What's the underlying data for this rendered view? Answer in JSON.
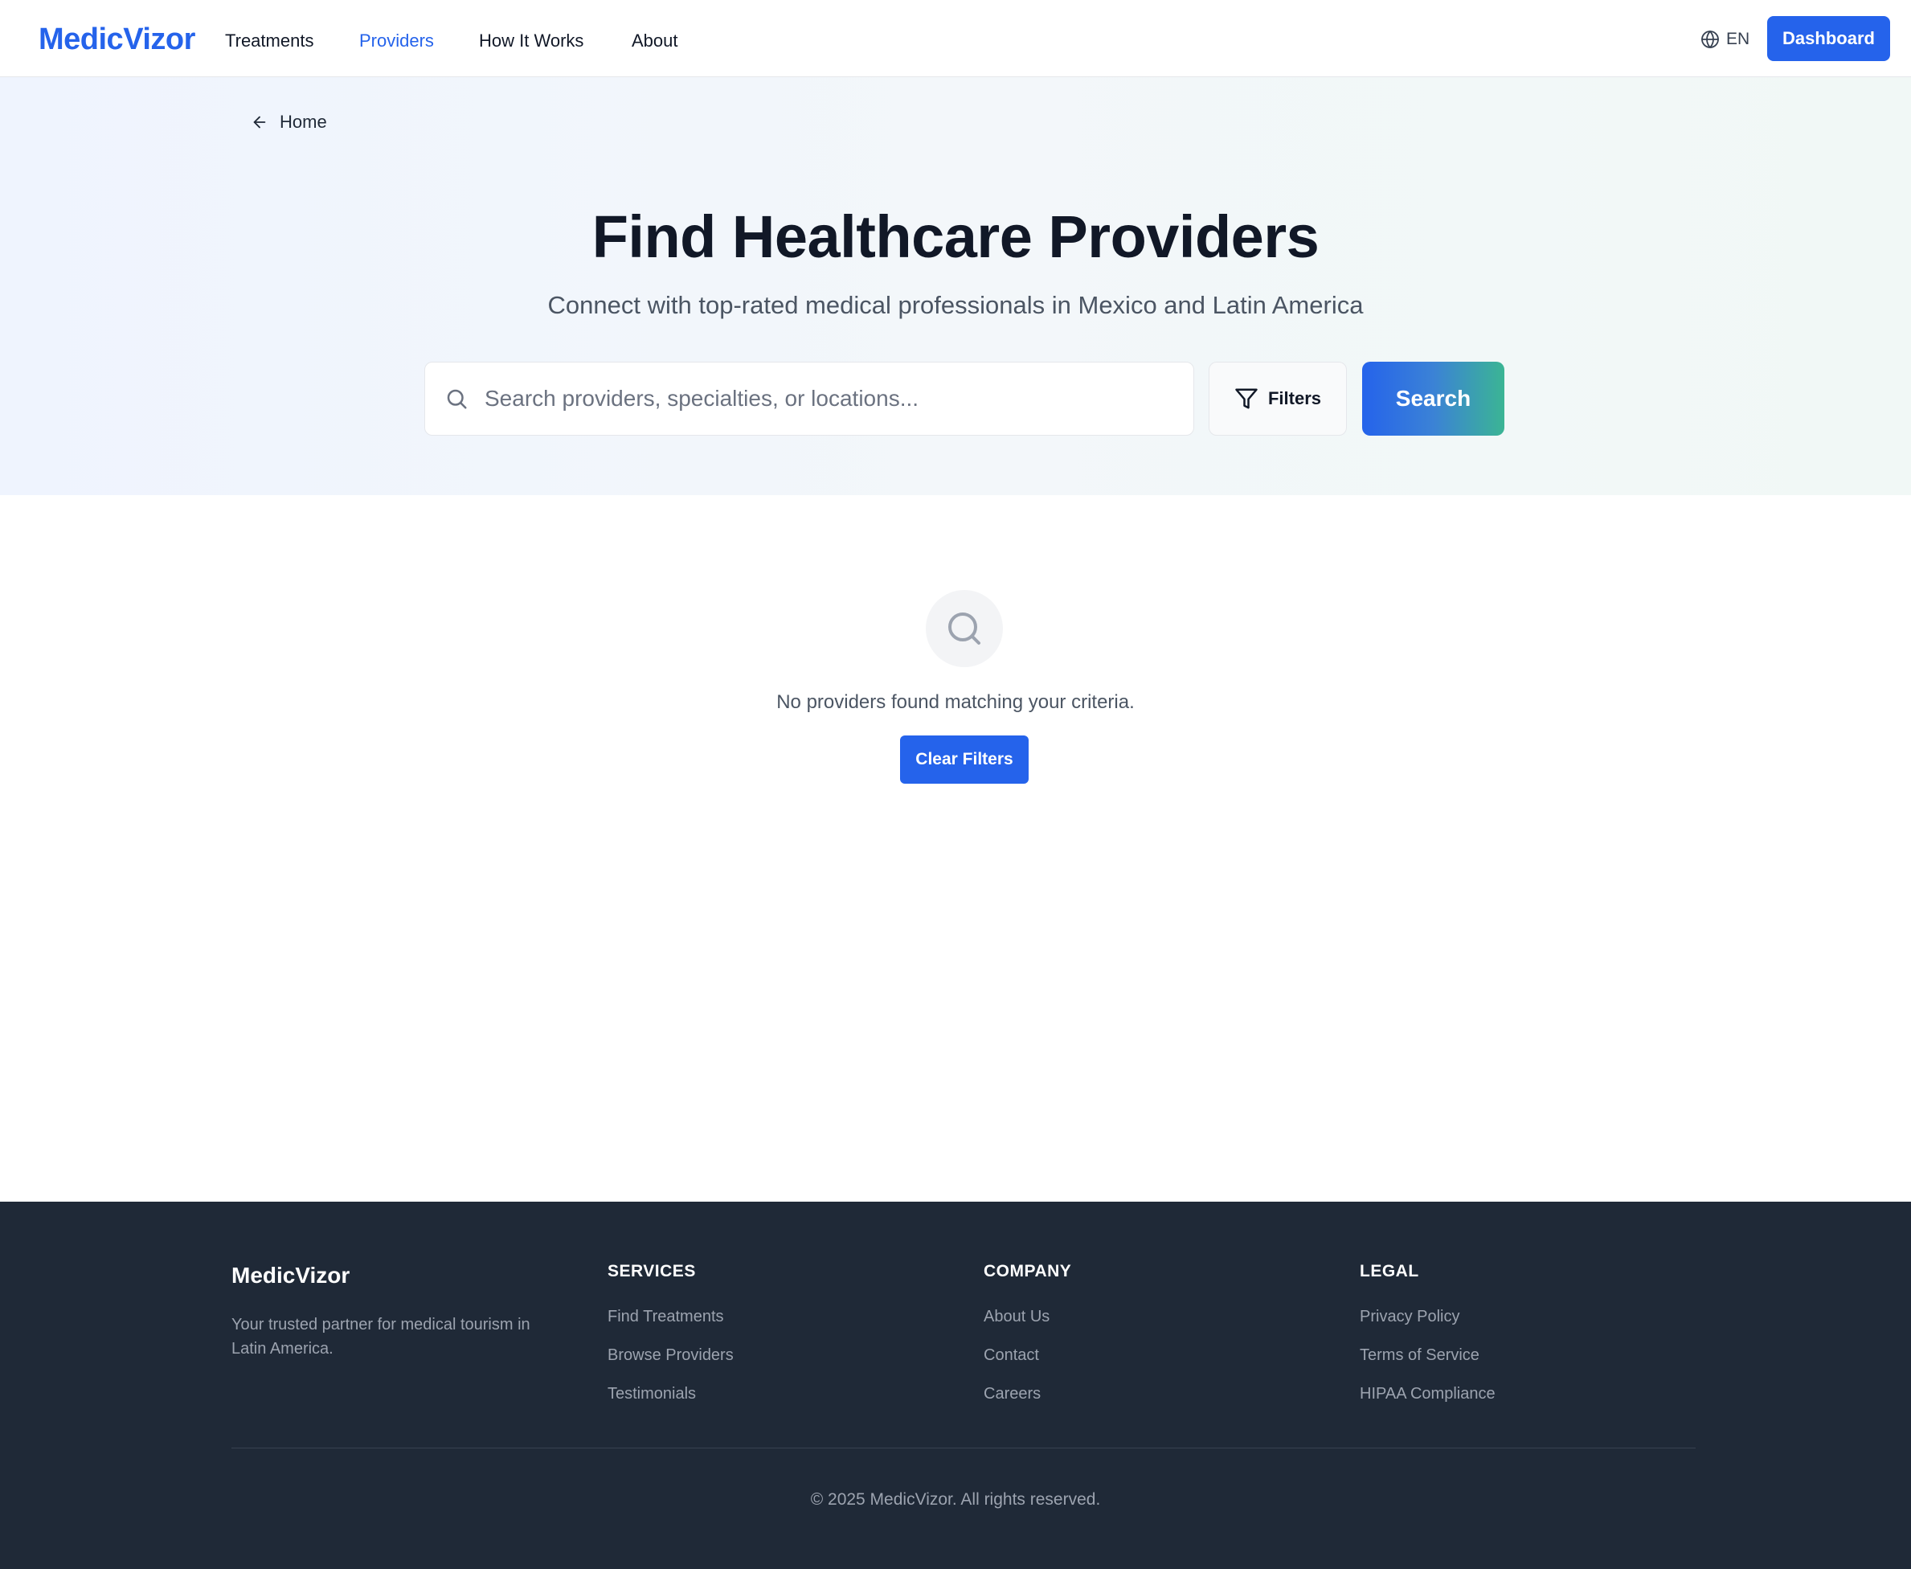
{
  "header": {
    "logo": "MedicVizor",
    "nav": [
      {
        "label": "Treatments",
        "active": false
      },
      {
        "label": "Providers",
        "active": true
      },
      {
        "label": "How It Works",
        "active": false
      },
      {
        "label": "About",
        "active": false
      }
    ],
    "language": {
      "icon": "globe-icon",
      "label": "EN"
    },
    "dashboard_label": "Dashboard"
  },
  "hero": {
    "back": {
      "icon": "arrow-left-icon",
      "label": "Home"
    },
    "title": "Find Healthcare Providers",
    "subtitle": "Connect with top-rated medical professionals in Mexico and Latin America",
    "search": {
      "icon": "search-icon",
      "value": "",
      "placeholder": "Search providers, specialties, or locations..."
    },
    "filters": {
      "icon": "filter-icon",
      "label": "Filters"
    },
    "search_button": "Search"
  },
  "results": {
    "empty_icon": "search-icon",
    "empty_message": "No providers found matching your criteria.",
    "clear_filters_label": "Clear Filters"
  },
  "footer": {
    "brand": "MedicVizor",
    "tagline": "Your trusted partner for medical tourism in Latin America.",
    "columns": [
      {
        "heading": "SERVICES",
        "links": [
          "Find Treatments",
          "Browse Providers",
          "Testimonials"
        ]
      },
      {
        "heading": "COMPANY",
        "links": [
          "About Us",
          "Contact",
          "Careers"
        ]
      },
      {
        "heading": "LEGAL",
        "links": [
          "Privacy Policy",
          "Terms of Service",
          "HIPAA Compliance"
        ]
      }
    ],
    "copyright": "© 2025 MedicVizor. All rights reserved."
  },
  "colors": {
    "primary": "#2563eb",
    "accent_teal": "#3bb594",
    "footer_bg": "#1f2937",
    "text_dark": "#111827",
    "text_muted": "#4b5563"
  }
}
